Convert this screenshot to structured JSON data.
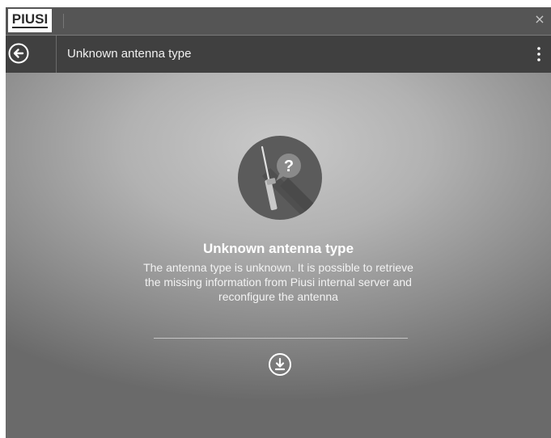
{
  "app": {
    "logo_text": "PIUSI",
    "close_symbol": "×"
  },
  "header": {
    "title": "Unknown antenna type",
    "back_icon": "arrow-left-circle-icon",
    "menu_icon": "kebab-menu-icon"
  },
  "message": {
    "icon": "antenna-question-icon",
    "title": "Unknown antenna type",
    "body": "The antenna type is unknown. It is possible to retrieve the missing information from Piusi internal server and reconfigure the antenna",
    "action_icon": "download-circle-icon"
  },
  "colors": {
    "titlebar": "#555555",
    "header": "#404040",
    "illustration_circle": "#5b5b5b"
  }
}
